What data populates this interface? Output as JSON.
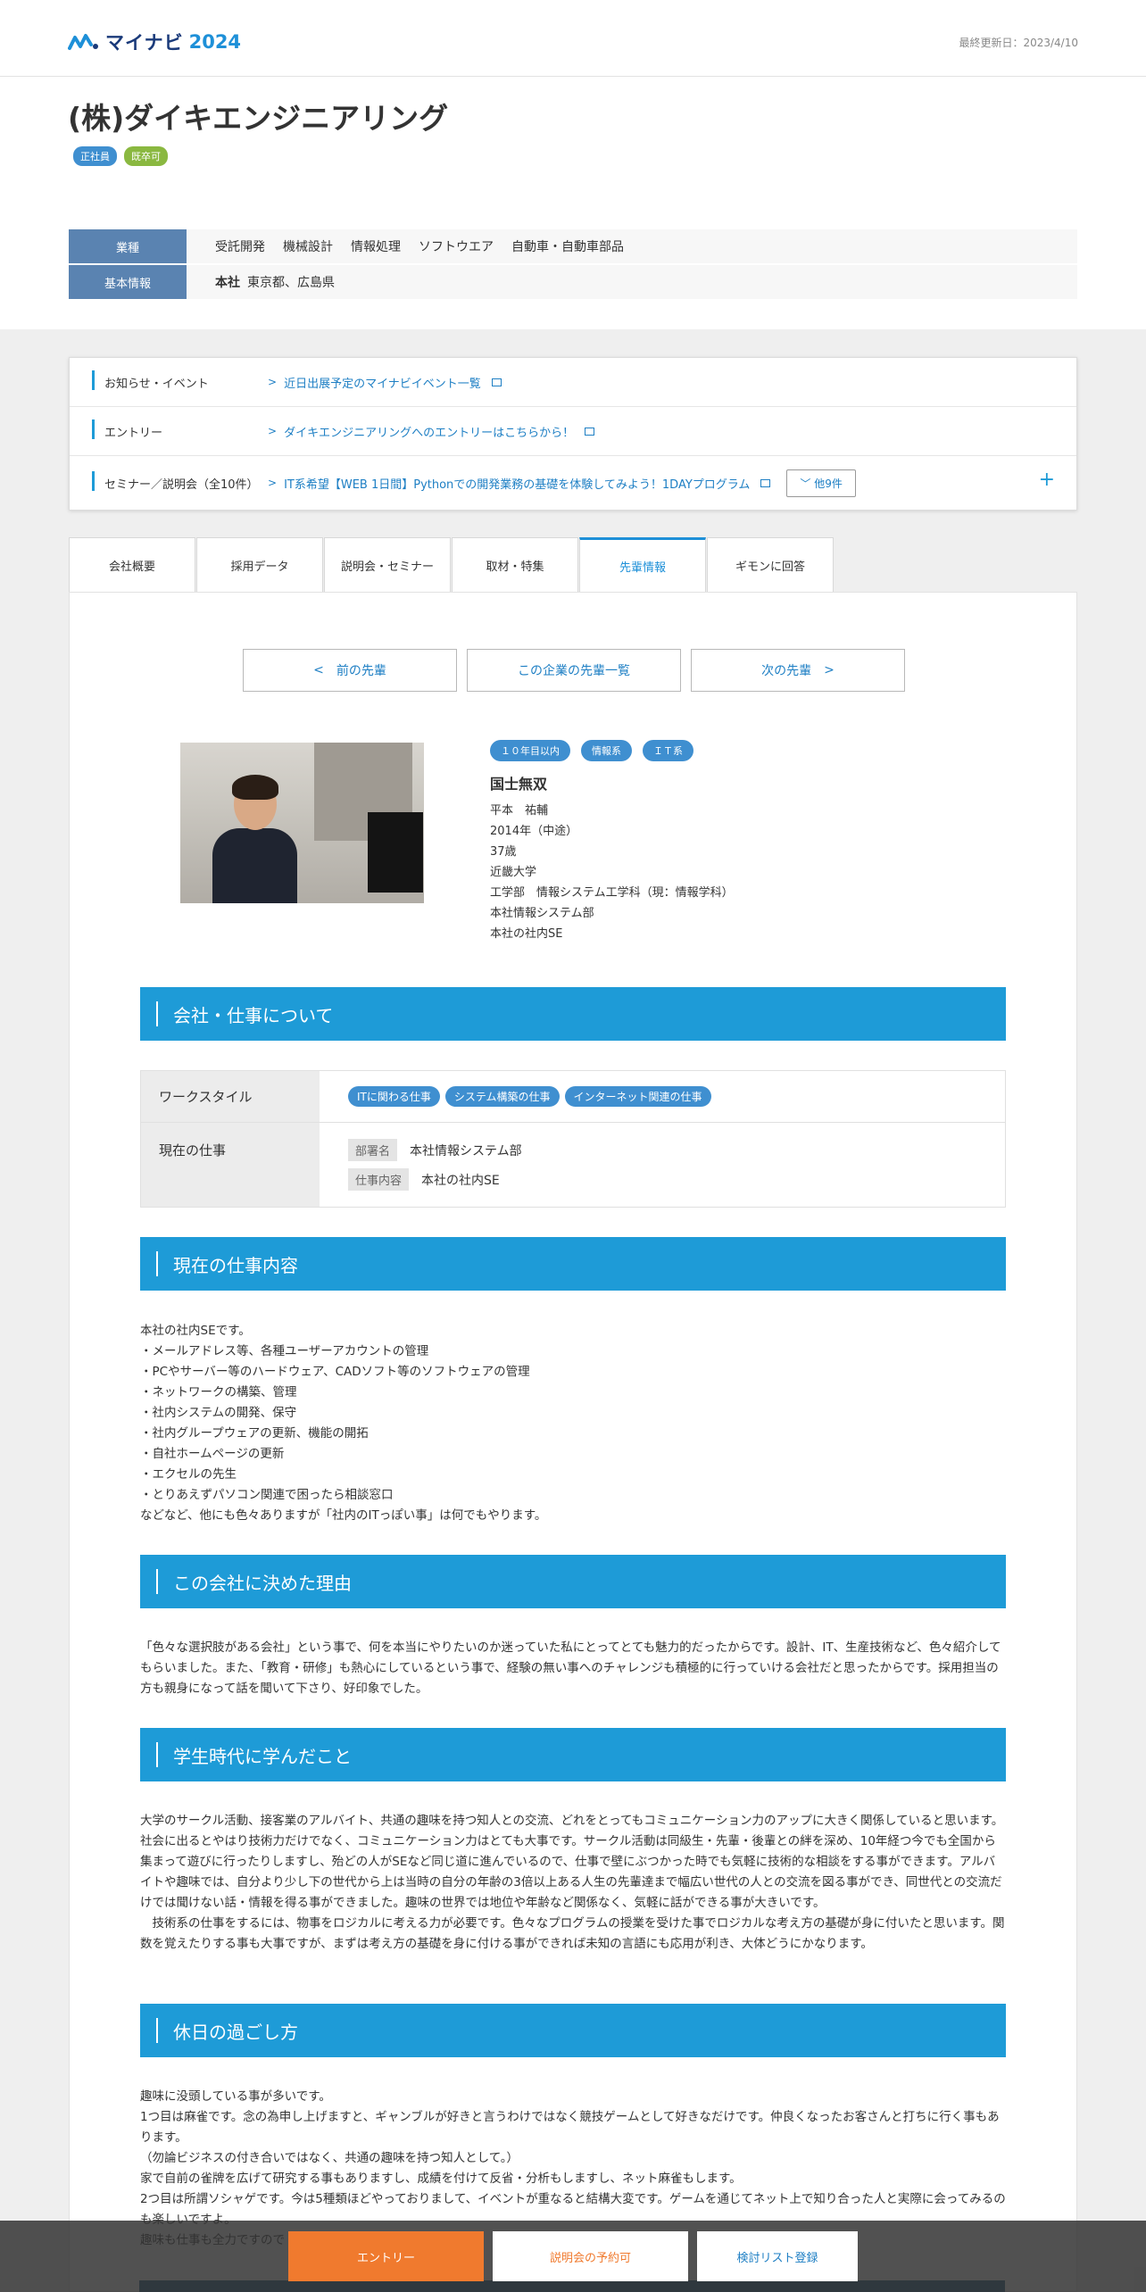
{
  "header": {
    "brand": "マイナビ",
    "year": "2024",
    "updated": "最終更新日：2023/4/10"
  },
  "company": {
    "name": "(株)ダイキエンジニアリング",
    "tags": [
      "正社員",
      "既卒可"
    ],
    "industry_label": "業種",
    "industries": [
      "受託開発",
      "機械設計",
      "情報処理",
      "ソフトウエア",
      "自動車・自動車部品"
    ],
    "basic_label": "基本情報",
    "hq_label": "本社",
    "hq_value": "東京都、広島県"
  },
  "notices": [
    {
      "label": "お知らせ・イベント",
      "link": "近日出展予定のマイナビイベント一覧"
    },
    {
      "label": "エントリー",
      "link": "ダイキエンジニアリングへのエントリーはこちらから！"
    },
    {
      "label": "セミナー／説明会（全10件）",
      "link": "IT系希望【WEB 1日間】Pythonでの開発業務の基礎を体験してみよう！1DAYプログラム",
      "more": "他9件"
    }
  ],
  "tabs": [
    "会社概要",
    "採用データ",
    "説明会・セミナー",
    "取材・特集",
    "先輩情報",
    "ギモンに回答"
  ],
  "nav": {
    "prev": "前の先輩",
    "list": "この企業の先輩一覧",
    "next": "次の先輩"
  },
  "profile": {
    "tags": [
      "１０年目以内",
      "情報系",
      "ＩＴ系"
    ],
    "title": "国士無双",
    "lines": [
      "平本　祐輔",
      "2014年（中途）",
      "37歳",
      "近畿大学",
      "工学部　情報システム工学科（現：情報学科）",
      "本社情報システム部",
      "本社の社内SE"
    ]
  },
  "sections": {
    "about": "会社・仕事について",
    "current_job": "現在の仕事内容",
    "reason": "この会社に決めた理由",
    "student": "学生時代に学んだこと",
    "holiday": "休日の過ごし方"
  },
  "workstyle": {
    "label": "ワークスタイル",
    "tags": [
      "ITに関わる仕事",
      "システム構築の仕事",
      "インターネット関連の仕事"
    ],
    "job_label": "現在の仕事",
    "dept_key": "部署名",
    "dept_value": "本社情報システム部",
    "task_key": "仕事内容",
    "task_value": "本社の社内SE"
  },
  "texts": {
    "current_job": "本社の社内SEです。\n・メールアドレス等、各種ユーザーアカウントの管理\n・PCやサーバー等のハードウェア、CADソフト等のソフトウェアの管理\n・ネットワークの構築、管理\n・社内システムの開発、保守\n・社内グループウェアの更新、機能の開拓\n・自社ホームページの更新\n・エクセルの先生\n・とりあえずパソコン関連で困ったら相談窓口\nなどなど、他にも色々ありますが「社内のITっぽい事」は何でもやります。",
    "reason": "「色々な選択肢がある会社」という事で、何を本当にやりたいのか迷っていた私にとってとても魅力的だったからです。設計、IT、生産技術など、色々紹介してもらいました。また、「教育・研修」も熱心にしているという事で、経験の無い事へのチャレンジも積極的に行っていける会社だと思ったからです。採用担当の方も親身になって話を聞いて下さり、好印象でした。",
    "student": "大学のサークル活動、接客業のアルバイト、共通の趣味を持つ知人との交流、どれをとってもコミュニケーション力のアップに大きく関係していると思います。社会に出るとやはり技術力だけでなく、コミュニケーション力はとても大事です。サークル活動は同級生・先輩・後輩との絆を深め、10年経つ今でも全国から集まって遊びに行ったりしますし、殆どの人がSEなど同じ道に進んでいるので、仕事で壁にぶつかった時でも気軽に技術的な相談をする事ができます。アルバイトや趣味では、自分より少し下の世代から上は当時の自分の年齢の3倍以上ある人生の先輩達まで幅広い世代の人との交流を図る事ができ、同世代との交流だけでは聞けない話・情報を得る事ができました。趣味の世界では地位や年齢など関係なく、気軽に話ができる事が大きいです。\n　技術系の仕事をするには、物事をロジカルに考える力が必要です。色々なプログラムの授業を受けた事でロジカルな考え方の基礎が身に付いたと思います。関数を覚えたりする事も大事ですが、まずは考え方の基礎を身に付ける事ができれば未知の言語にも応用が利き、大体どうにかなります。",
    "holiday": "趣味に没頭している事が多いです。\n1つ目は麻雀です。念の為申し上げますと、ギャンブルが好きと言うわけではなく競技ゲームとして好きなだけです。仲良くなったお客さんと打ちに行く事もあります。\n（勿論ビジネスの付き合いではなく、共通の趣味を持つ知人として。）\n家で自前の雀牌を広げて研究する事もありますし、成績を付けて反省・分析もしますし、ネット麻雀もします。\n2つ目は所謂ソシャゲです。今は5種類ほどやっておりまして、イベントが重なると結構大変です。ゲームを通じてネット上で知り合った人と実際に会ってみるのも楽しいですよ。\n趣味も仕事も全力ですので"
  },
  "bottom": {
    "entry": "エントリー",
    "seminar": "説明会の予約可",
    "list": "検討リスト登録"
  }
}
